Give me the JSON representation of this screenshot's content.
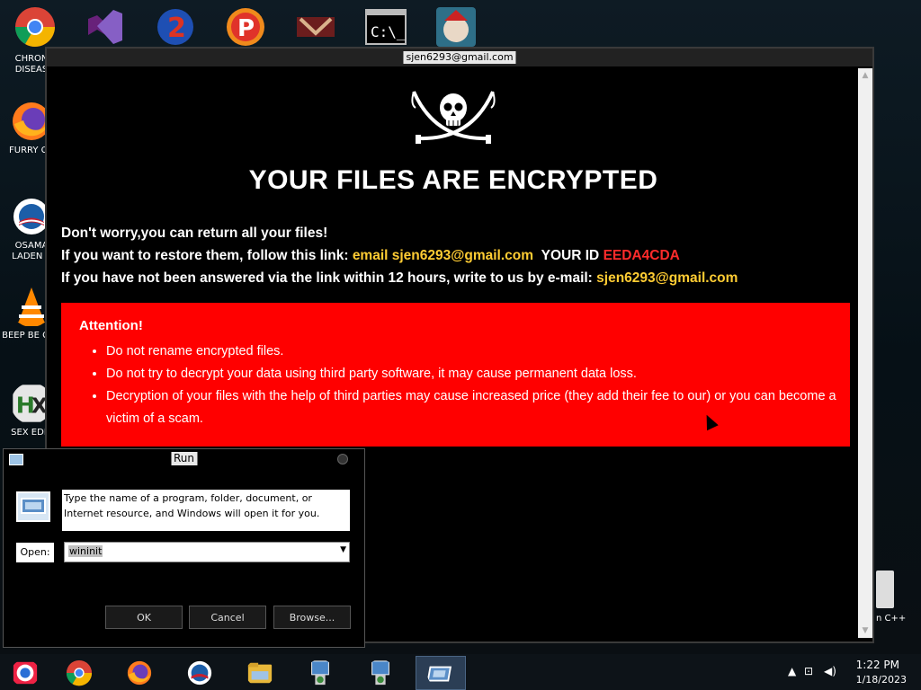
{
  "ransom": {
    "window_title": "sjen6293@gmail.com",
    "headline": "YOUR FILES ARE ENCRYPTED",
    "line1": "Don't worry,you can return all your files!",
    "line2_prefix": "If you want to restore them, follow this link: ",
    "line2_email": "email sjen6293@gmail.com",
    "line2_id_label": "YOUR ID ",
    "line2_id_value": "EEDA4CDA",
    "line3_prefix": "If you have not been answered via the link within 12 hours, write to us by e-mail: ",
    "line3_email": "sjen6293@gmail.com",
    "attention_title": "Attention!",
    "attention_items": [
      "Do not rename encrypted files.",
      "Do not try to decrypt your data using third party software, it may cause permanent data loss.",
      "Decryption of your files with the help of third parties may cause increased price (they add their fee to our) or you can become a victim of a scam."
    ]
  },
  "run_dialog": {
    "title": "Run",
    "description": "Type the name of a program, folder, document, or Internet resource, and Windows will open it for you.",
    "open_label": "Open:",
    "input_value": "wininit",
    "ok_label": "OK",
    "cancel_label": "Cancel",
    "browse_label": "Browse..."
  },
  "desktop_icons": [
    {
      "label": "CHRON DISEAS",
      "icon": "chrome-icon"
    },
    {
      "label": "FURRY CU",
      "icon": "firefox-icon"
    },
    {
      "label": "OSAMA LADEN E",
      "icon": "obama-logo-icon"
    },
    {
      "label": "BEEP BE CAR",
      "icon": "vlc-icon"
    },
    {
      "label": "SEX EDIT",
      "icon": "hex-editor-icon"
    }
  ],
  "right_icon_label": "n C++",
  "taskbar": {
    "items": [
      "chrome-icon",
      "chrome-icon",
      "firefox-icon",
      "obama-logo-icon",
      "explorer-icon",
      "installer-icon",
      "installer-icon",
      "run-icon"
    ],
    "time": "1:22 PM",
    "date": "1/18/2023"
  },
  "colors": {
    "attention_bg": "#ff0000",
    "highlight_yellow": "#ffcc33",
    "id_red": "#ff2b2b"
  }
}
